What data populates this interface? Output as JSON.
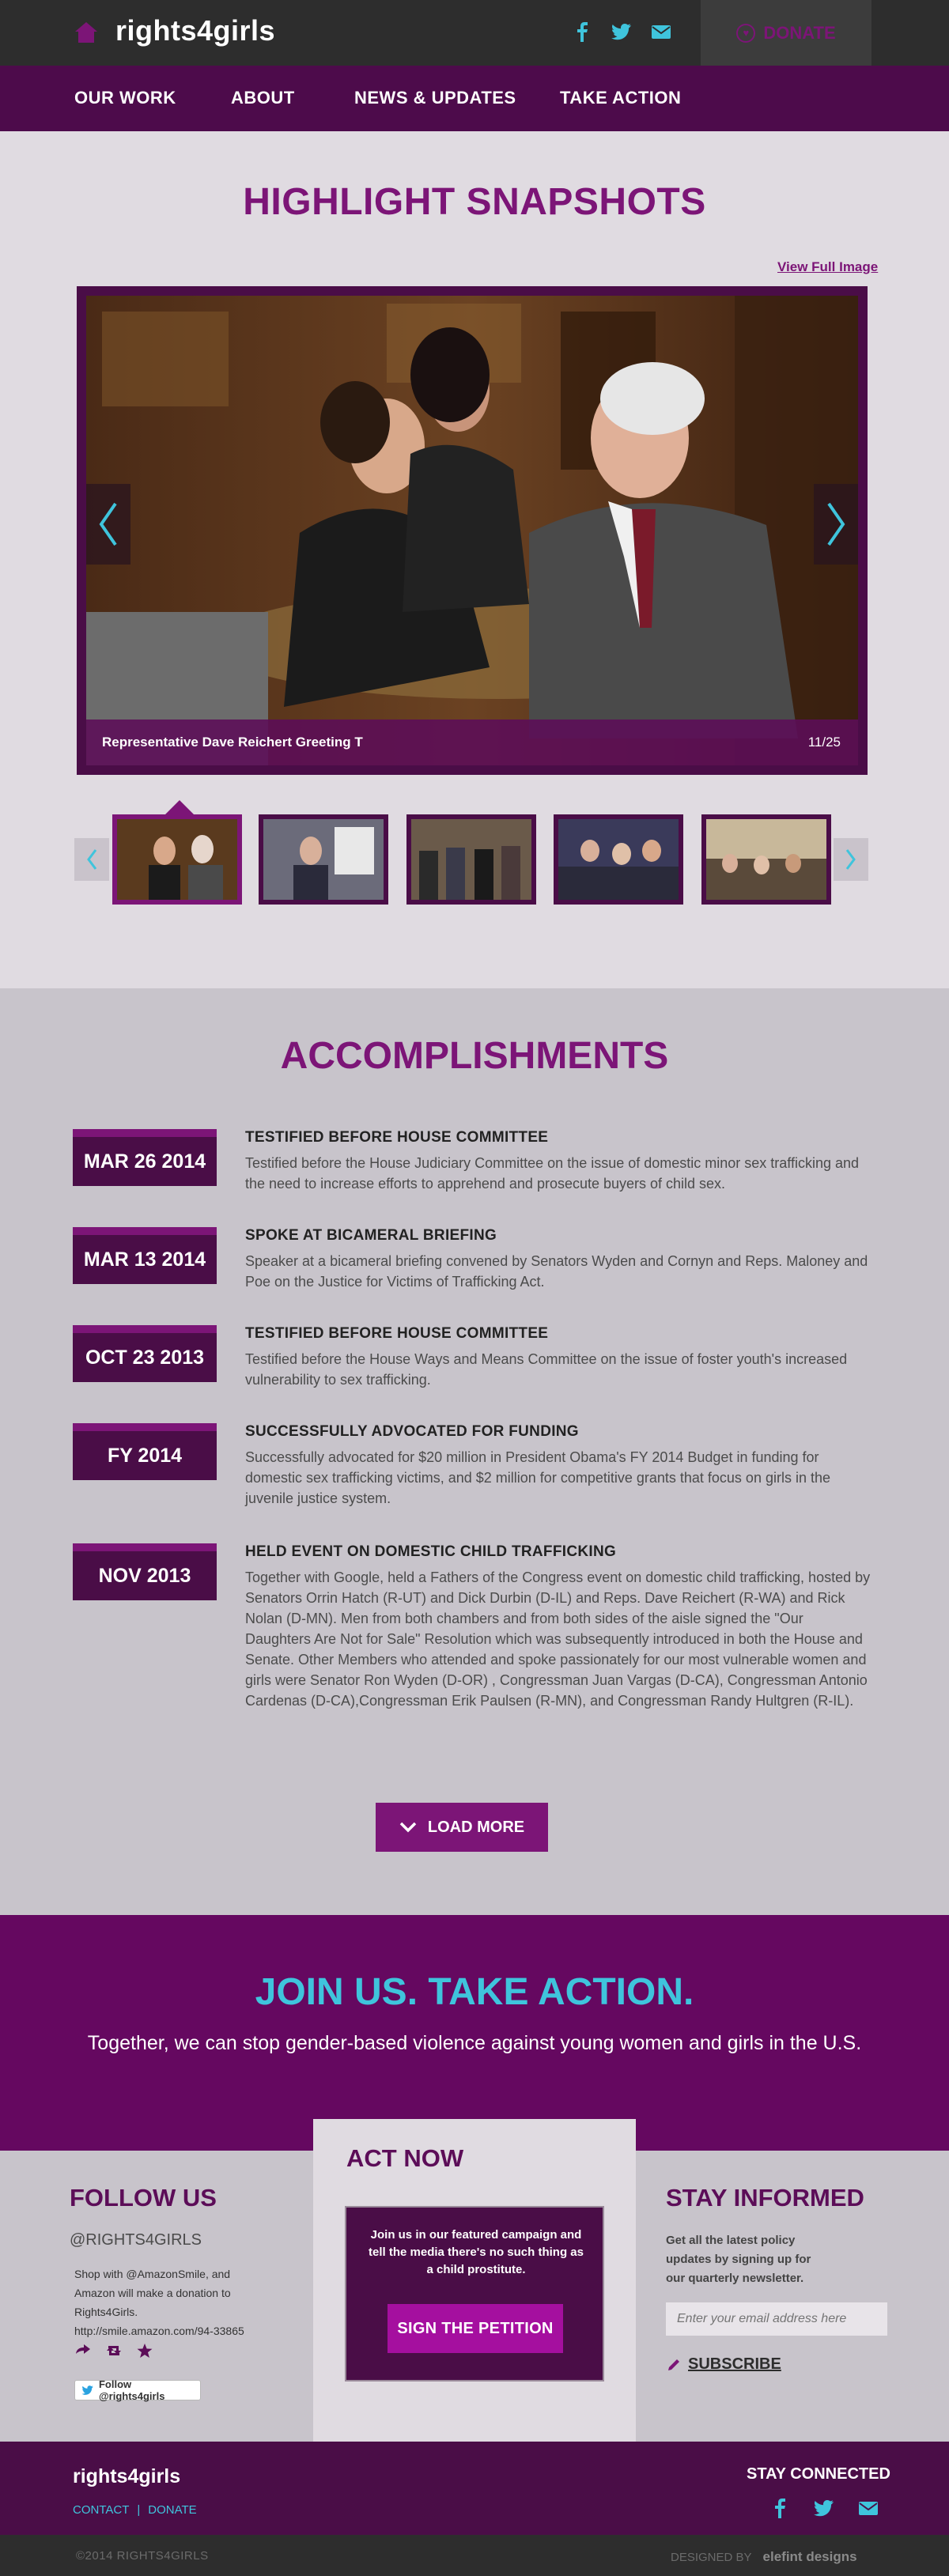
{
  "brand": {
    "logo_text": "rights4girls",
    "accent": "#7c1577",
    "dark": "#4a0d47",
    "cyan": "#3fc4dc"
  },
  "header": {
    "social": [
      "facebook-icon",
      "twitter-icon",
      "email-icon"
    ],
    "donate_label": "DONATE"
  },
  "nav": {
    "items": [
      "OUR WORK",
      "ABOUT",
      "NEWS & UPDATES",
      "TAKE ACTION"
    ]
  },
  "highlights": {
    "title": "HIGHLIGHT SNAPSHOTS",
    "view_full": "View Full Image",
    "caption": "Representative Dave Reichert Greeting T",
    "counter": "11/25"
  },
  "accomplishments": {
    "title": "ACCOMPLISHMENTS",
    "items": [
      {
        "date": "MAR 26 2014",
        "heading": "TESTIFIED BEFORE HOUSE COMMITTEE",
        "body": "Testified before the House Judiciary Committee on the issue of domestic minor sex trafficking and the need to increase efforts to apprehend and prosecute buyers of child sex."
      },
      {
        "date": "MAR 13 2014",
        "heading": "SPOKE AT BICAMERAL BRIEFING",
        "body": "Speaker at a bicameral briefing convened by Senators Wyden and Cornyn and Reps. Maloney and Poe on the Justice for Victims of Trafficking Act."
      },
      {
        "date": "OCT 23 2013",
        "heading": "TESTIFIED BEFORE HOUSE COMMITTEE",
        "body": "Testified before the House Ways and Means Committee on the issue of foster youth's increased vulnerability to sex trafficking."
      },
      {
        "date": "FY 2014",
        "heading": "SUCCESSFULLY ADVOCATED FOR FUNDING",
        "body": "Successfully advocated for $20 million in President Obama's FY 2014 Budget in funding for domestic sex trafficking victims, and $2 million for competitive grants that focus on girls in the juvenile justice system."
      },
      {
        "date": "NOV 2013",
        "heading": "HELD EVENT ON DOMESTIC CHILD TRAFFICKING",
        "body": "Together with Google, held a Fathers of the Congress event on domestic child trafficking, hosted by Senators Orrin Hatch (R-UT) and Dick Durbin (D-IL) and Reps. Dave Reichert (R-WA) and Rick Nolan (D-MN). Men from both chambers and from both sides of the aisle signed the \"Our Daughters Are Not for Sale\" Resolution which was subsequently introduced in both the House and Senate.  Other Members who attended and spoke passionately for our most vulnerable women and girls were Senator Ron Wyden (D-OR) , Congressman Juan Vargas (D-CA), Congressman Antonio Cardenas (D-CA),Congressman Erik Paulsen (R-MN), and Congressman Randy Hultgren (R-IL)."
      }
    ],
    "load_more": "LOAD MORE"
  },
  "join": {
    "title": "JOIN US. TAKE ACTION.",
    "subtitle": "Together, we can stop gender-based violence against young women and girls in the U.S."
  },
  "follow": {
    "title": "FOLLOW US",
    "handle": "@RIGHTS4GIRLS",
    "shop_text": "Shop with @AmazonSmile, and Amazon will make a donation to Rights4Girls. http://smile.amazon.com/94-33865",
    "follow_button": "Follow @rights4girls"
  },
  "act_now": {
    "title": "ACT NOW",
    "text": "Join us in our featured campaign and tell the media there's no such thing as a child prostitute.",
    "button": "SIGN THE PETITION"
  },
  "stay_informed": {
    "title": "STAY INFORMED",
    "text": "Get all the latest policy updates by signing up for our quarterly newsletter.",
    "email_placeholder": "Enter your email address here",
    "subscribe": "SUBSCRIBE"
  },
  "footer": {
    "logo": "rights4girls",
    "links": [
      "CONTACT",
      "DONATE"
    ],
    "separator": "|",
    "stay_connected": "STAY CONNECTED",
    "copyright": "©2014 RIGHTS4GIRLS",
    "designed_by": "DESIGNED BY",
    "designer": "elefint designs"
  }
}
